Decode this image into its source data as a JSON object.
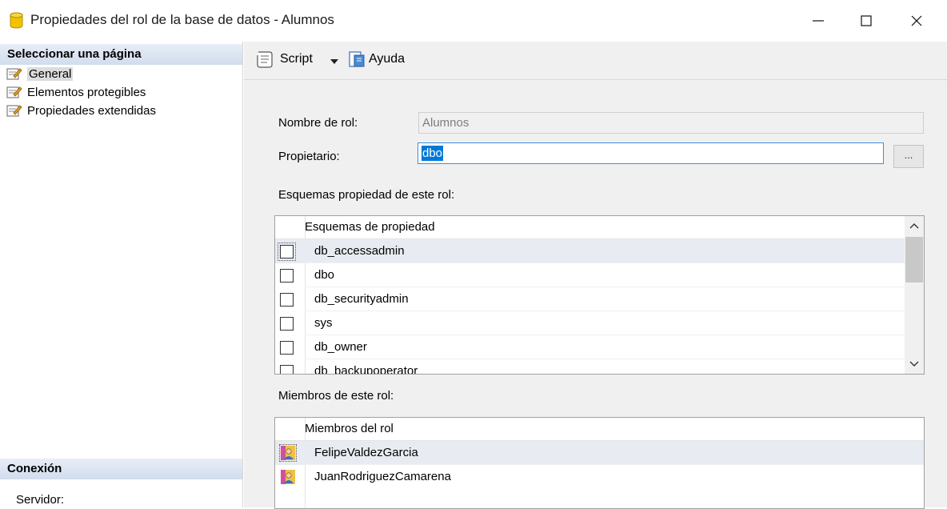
{
  "window": {
    "title": "Propiedades del rol de la base de datos - Alumnos",
    "minimize_glyph": "—",
    "maximize_glyph": "☐",
    "close_glyph": "✕"
  },
  "left_panel": {
    "select_page_header": "Seleccionar una página",
    "pages": [
      {
        "label": "General",
        "icon": "page-wrench-icon",
        "selected": true
      },
      {
        "label": "Elementos protegibles",
        "icon": "page-wrench-icon",
        "selected": false
      },
      {
        "label": "Propiedades extendidas",
        "icon": "page-wrench-icon",
        "selected": false
      }
    ],
    "connection_header": "Conexión",
    "server_label": "Servidor:"
  },
  "toolbar": {
    "script_label": "Script",
    "help_label": "Ayuda"
  },
  "form": {
    "role_name_label": "Nombre de rol:",
    "role_name_value": "Alumnos",
    "owner_label": "Propietario:",
    "owner_value": "dbo",
    "browse_label": "...",
    "schemas_label": "Esquemas propiedad de este rol:",
    "members_label": "Miembros de este rol:"
  },
  "schemas_grid": {
    "header": "Esquemas de propiedad",
    "rows": [
      {
        "name": "db_accessadmin",
        "checked": false,
        "selected": true
      },
      {
        "name": "dbo",
        "checked": false,
        "selected": false
      },
      {
        "name": "db_securityadmin",
        "checked": false,
        "selected": false
      },
      {
        "name": "sys",
        "checked": false,
        "selected": false
      },
      {
        "name": "db_owner",
        "checked": false,
        "selected": false
      },
      {
        "name": "db_backupoperator",
        "checked": false,
        "selected": false
      }
    ]
  },
  "members_grid": {
    "header": "Miembros del rol",
    "rows": [
      {
        "name": "FelipeValdezGarcia",
        "icon": "user-icon",
        "selected": true
      },
      {
        "name": "JuanRodriguezCamarena",
        "icon": "user-icon",
        "selected": false
      }
    ]
  },
  "colors": {
    "selection_blue": "#0078d7",
    "panel_bg": "#f0f0f0",
    "header_gradient_top": "#e7eef8",
    "header_gradient_bottom": "#d2dcec"
  }
}
